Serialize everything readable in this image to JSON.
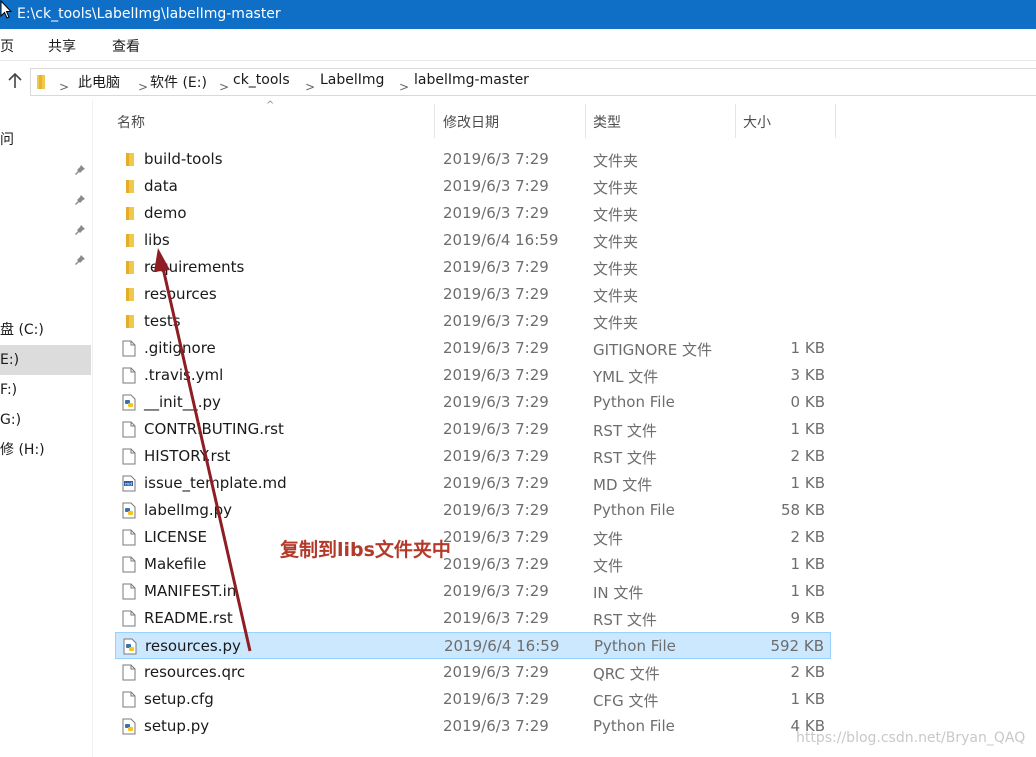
{
  "window": {
    "title": "E:\\ck_tools\\LabelImg\\labelImg-master"
  },
  "ribbon": {
    "tabs": [
      "页",
      "共享",
      "查看"
    ]
  },
  "address": {
    "crumbs": [
      "此电脑",
      "软件 (E:)",
      "ck_tools",
      "LabelImg",
      "labelImg-master"
    ],
    "separator": ">"
  },
  "navpane": {
    "items": [
      {
        "label": "问",
        "selected": false
      },
      {
        "label": "盘 (C:)",
        "selected": false
      },
      {
        "label": "E:)",
        "selected": true
      },
      {
        "label": "F:)",
        "selected": false
      },
      {
        "label": "G:)",
        "selected": false
      },
      {
        "label": "修 (H:)",
        "selected": false
      }
    ],
    "pin_icon": "pin-icon"
  },
  "columns": {
    "name": "名称",
    "date": "修改日期",
    "type": "类型",
    "size": "大小"
  },
  "files": [
    {
      "name": "build-tools",
      "date": "2019/6/3 7:29",
      "type": "文件夹",
      "size": "",
      "icon": "folder"
    },
    {
      "name": "data",
      "date": "2019/6/3 7:29",
      "type": "文件夹",
      "size": "",
      "icon": "folder"
    },
    {
      "name": "demo",
      "date": "2019/6/3 7:29",
      "type": "文件夹",
      "size": "",
      "icon": "folder"
    },
    {
      "name": "libs",
      "date": "2019/6/4 16:59",
      "type": "文件夹",
      "size": "",
      "icon": "folder"
    },
    {
      "name": "requirements",
      "date": "2019/6/3 7:29",
      "type": "文件夹",
      "size": "",
      "icon": "folder"
    },
    {
      "name": "resources",
      "date": "2019/6/3 7:29",
      "type": "文件夹",
      "size": "",
      "icon": "folder"
    },
    {
      "name": "tests",
      "date": "2019/6/3 7:29",
      "type": "文件夹",
      "size": "",
      "icon": "folder"
    },
    {
      "name": ".gitignore",
      "date": "2019/6/3 7:29",
      "type": "GITIGNORE 文件",
      "size": "1 KB",
      "icon": "file"
    },
    {
      "name": ".travis.yml",
      "date": "2019/6/3 7:29",
      "type": "YML 文件",
      "size": "3 KB",
      "icon": "file"
    },
    {
      "name": "__init__.py",
      "date": "2019/6/3 7:29",
      "type": "Python File",
      "size": "0 KB",
      "icon": "python"
    },
    {
      "name": "CONTRIBUTING.rst",
      "date": "2019/6/3 7:29",
      "type": "RST 文件",
      "size": "1 KB",
      "icon": "file"
    },
    {
      "name": "HISTORY.rst",
      "date": "2019/6/3 7:29",
      "type": "RST 文件",
      "size": "2 KB",
      "icon": "file"
    },
    {
      "name": "issue_template.md",
      "date": "2019/6/3 7:29",
      "type": "MD 文件",
      "size": "1 KB",
      "icon": "markdown"
    },
    {
      "name": "labelImg.py",
      "date": "2019/6/3 7:29",
      "type": "Python File",
      "size": "58 KB",
      "icon": "python"
    },
    {
      "name": "LICENSE",
      "date": "2019/6/3 7:29",
      "type": "文件",
      "size": "2 KB",
      "icon": "file"
    },
    {
      "name": "Makefile",
      "date": "2019/6/3 7:29",
      "type": "文件",
      "size": "1 KB",
      "icon": "file"
    },
    {
      "name": "MANIFEST.in",
      "date": "2019/6/3 7:29",
      "type": "IN 文件",
      "size": "1 KB",
      "icon": "file"
    },
    {
      "name": "README.rst",
      "date": "2019/6/3 7:29",
      "type": "RST 文件",
      "size": "9 KB",
      "icon": "file"
    },
    {
      "name": "resources.py",
      "date": "2019/6/4 16:59",
      "type": "Python File",
      "size": "592 KB",
      "icon": "python",
      "selected": true
    },
    {
      "name": "resources.qrc",
      "date": "2019/6/3 7:29",
      "type": "QRC 文件",
      "size": "2 KB",
      "icon": "file"
    },
    {
      "name": "setup.cfg",
      "date": "2019/6/3 7:29",
      "type": "CFG 文件",
      "size": "1 KB",
      "icon": "file"
    },
    {
      "name": "setup.py",
      "date": "2019/6/3 7:29",
      "type": "Python File",
      "size": "4 KB",
      "icon": "python"
    }
  ],
  "annotation": {
    "text": "复制到libs文件夹中",
    "color": "#b33a2b"
  },
  "watermark": "https://blog.csdn.net/Bryan_QAQ",
  "colors": {
    "titlebar": "#0f6fc6",
    "selection": "#cce8ff",
    "folder": "#f2c84b"
  }
}
